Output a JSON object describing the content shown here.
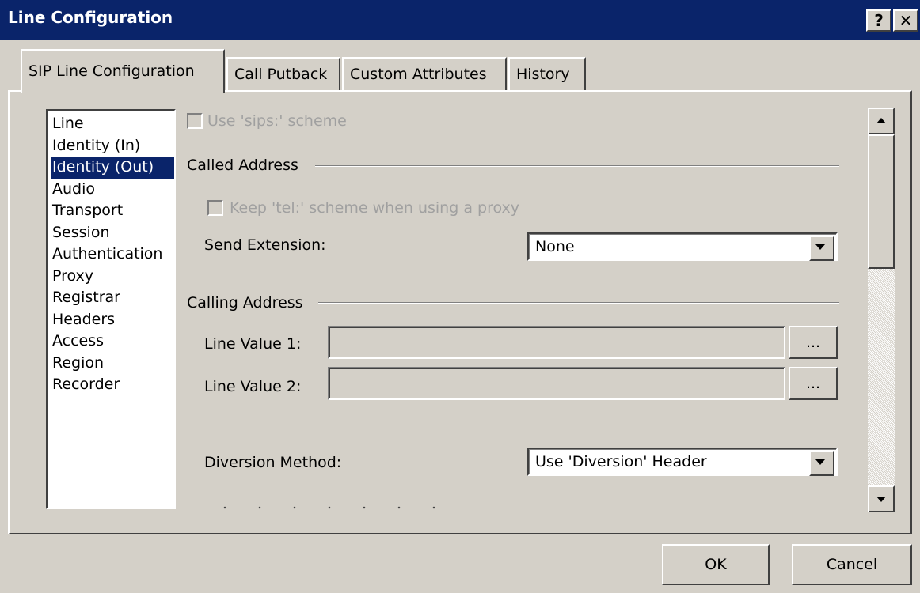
{
  "window": {
    "title": "Line Configuration",
    "help_label": "?",
    "close_label": "✕"
  },
  "tabs": [
    {
      "label": "SIP Line Configuration",
      "active": true
    },
    {
      "label": "Call Putback",
      "active": false
    },
    {
      "label": "Custom Attributes",
      "active": false
    },
    {
      "label": "History",
      "active": false
    }
  ],
  "categories": [
    "Line",
    "Identity (In)",
    "Identity (Out)",
    "Audio",
    "Transport",
    "Session",
    "Authentication",
    "Proxy",
    "Registrar",
    "Headers",
    "Access",
    "Region",
    "Recorder"
  ],
  "selected_category": "Identity (Out)",
  "form": {
    "use_sips_label": "Use 'sips:' scheme",
    "use_sips_checked": false,
    "called_address_label": "Called Address",
    "keep_tel_label": "Keep 'tel:' scheme when using a proxy",
    "keep_tel_checked": false,
    "send_extension_label": "Send Extension:",
    "send_extension_value": "None",
    "calling_address_label": "Calling Address",
    "line_value_1_label": "Line Value 1:",
    "line_value_1": "",
    "line_value_2_label": "Line Value 2:",
    "line_value_2": "",
    "browse_label": "...",
    "diversion_method_label": "Diversion Method:",
    "diversion_method_value": "Use 'Diversion' Header"
  },
  "footer": {
    "ok_label": "OK",
    "cancel_label": "Cancel"
  }
}
